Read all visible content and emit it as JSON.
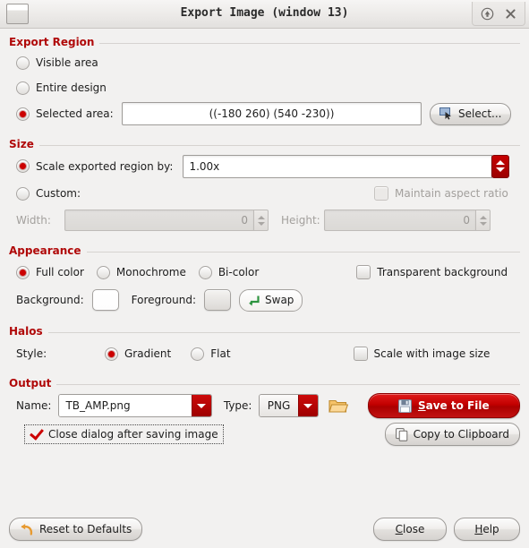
{
  "window": {
    "title": "Export Image (window 13)",
    "icon": "window-icon",
    "buttons": [
      {
        "name": "shade-button",
        "glyph": "shade-up-icon"
      },
      {
        "name": "close-button",
        "glyph": "close-icon"
      }
    ]
  },
  "sections": {
    "export_region": {
      "title": "Export Region",
      "options": [
        {
          "label": "Visible area",
          "selected": false
        },
        {
          "label": "Entire design",
          "selected": false
        },
        {
          "label": "Selected area:",
          "selected": true
        }
      ],
      "selected_area_value": "((-180 260) (540 -230))",
      "select_button": "Select...",
      "select_button_icon": "select-area-icon"
    },
    "size": {
      "title": "Size",
      "scale_option_label": "Scale exported region by:",
      "scale_option_selected": true,
      "scale_value": "1.00x",
      "custom_option_label": "Custom:",
      "custom_option_selected": false,
      "maintain_aspect_label": "Maintain aspect ratio",
      "maintain_aspect_checked": false,
      "maintain_aspect_disabled": true,
      "width_label": "Width:",
      "width_value": "0",
      "height_label": "Height:",
      "height_value": "0",
      "dimensions_disabled": true
    },
    "appearance": {
      "title": "Appearance",
      "color_modes": [
        {
          "label": "Full color",
          "selected": true
        },
        {
          "label": "Monochrome",
          "selected": false
        },
        {
          "label": "Bi-color",
          "selected": false
        }
      ],
      "transparent_label": "Transparent background",
      "transparent_checked": false,
      "background_label": "Background:",
      "background_color": "#ffffff",
      "foreground_label": "Foreground:",
      "foreground_color": "#e8e6e3",
      "swap_label": "Swap",
      "swap_icon": "swap-arrow-icon",
      "swap_icon_color": "#2e9440"
    },
    "halos": {
      "title": "Halos",
      "style_label": "Style:",
      "styles": [
        {
          "label": "Gradient",
          "selected": true
        },
        {
          "label": "Flat",
          "selected": false
        }
      ],
      "scale_with_image_label": "Scale with image size",
      "scale_with_image_checked": false
    },
    "output": {
      "title": "Output",
      "name_label": "Name:",
      "name_value": "TB_AMP.png",
      "type_label": "Type:",
      "type_value": "PNG",
      "browse_icon": "folder-open-icon",
      "save_button": "Save to File",
      "save_button_accel": "S",
      "save_button_icon": "floppy-save-icon",
      "close_dialog_label": "Close dialog after saving image",
      "close_dialog_checked": true,
      "copy_clipboard_button": "Copy to Clipboard",
      "copy_clipboard_icon": "clipboard-icon"
    }
  },
  "footer": {
    "reset_button": "Reset to Defaults",
    "reset_icon": "undo-arrow-icon",
    "close_button": "Close",
    "close_accel": "C",
    "help_button": "Help",
    "help_accel": "H"
  },
  "colors": {
    "accent_red": "#b00909",
    "button_red": "#c20000",
    "section_rule": "#d6d3d0",
    "dialog_bg": "#f2f1f0"
  }
}
